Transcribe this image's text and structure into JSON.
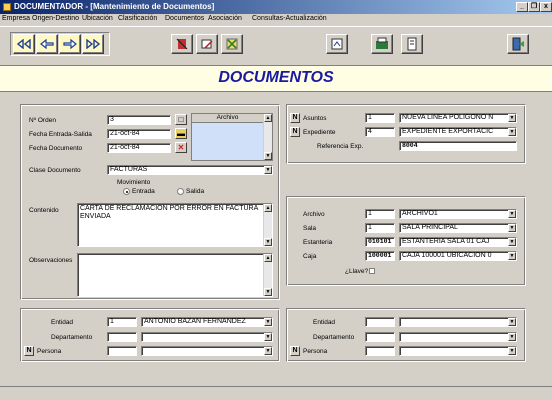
{
  "window": {
    "title": "DOCUMENTADOR - [Mantenimiento de Documentos]",
    "minimize": "_",
    "restore": "❐",
    "close": "x"
  },
  "menu": [
    "Empresa",
    "Origen-Destino",
    "Ubicación",
    "Clasificación",
    "Documentos",
    "Asociación",
    "Consultas-Actualización"
  ],
  "toolbar": {
    "first": "first-record-icon",
    "prev": "previous-record-icon",
    "next": "next-record-icon",
    "last": "last-record-icon",
    "delete": "delete-icon",
    "edit": "edit-icon",
    "cancel": "cancel-icon",
    "search": "search-icon",
    "save": "save-icon",
    "print": "print-icon",
    "exit": "exit-icon"
  },
  "header": {
    "title": "DOCUMENTOS"
  },
  "documento": {
    "n_orden_label": "Nº Orden",
    "n_orden": "3",
    "fecha_es_label": "Fecha Entrada-Salida",
    "fecha_es": "21-oct-84",
    "fecha_doc_label": "Fecha Documento",
    "fecha_doc": "21-oct-84",
    "archivo_label": "Archivo",
    "clase_label": "Clase Documento",
    "clase": "FACTURAS",
    "movimiento_label": "Movimiento",
    "entrada_label": "Entrada",
    "salida_label": "Salida",
    "contenido_label": "Contenido",
    "contenido": "CARTA DE RECLAMACION POR ERROR EN FACTURA ENVIADA",
    "observaciones_label": "Observaciones",
    "observaciones": ""
  },
  "asunto": {
    "n_button": "N",
    "asuntos_label": "Asuntos",
    "asuntos_code": "1",
    "asuntos_value": "NUEVA LINEA POLIGONO N",
    "expediente_label": "Expediente",
    "expediente_code": "4",
    "expediente_value": "EXPEDIENTE EXPORTACIC",
    "referencia_label": "Referencia Exp.",
    "referencia": "8004"
  },
  "ubicacion": {
    "archivo_label": "Archivo",
    "archivo_code": "1",
    "archivo_value": "ARCHIVO1",
    "sala_label": "Sala",
    "sala_code": "1",
    "sala_value": "SALA PRINCIPAL",
    "estanteria_label": "Estanteria",
    "estanteria_code": "010101",
    "estanteria_value": "ESTANTERIA SALA 01 CAJ",
    "caja_label": "Caja",
    "caja_code": "100001",
    "caja_value": "CAJA 100001 UBICACION 0",
    "llave_label": "¿Llave?"
  },
  "origen": {
    "entidad_label": "Entidad",
    "entidad_code": "1",
    "entidad_value": "ANTONIO BAZAN FERNANDEZ",
    "departamento_label": "Departamento",
    "persona_label": "Persona",
    "n_button": "N"
  },
  "destino": {
    "entidad_label": "Entidad",
    "departamento_label": "Departamento",
    "persona_label": "Persona",
    "n_button": "N"
  }
}
